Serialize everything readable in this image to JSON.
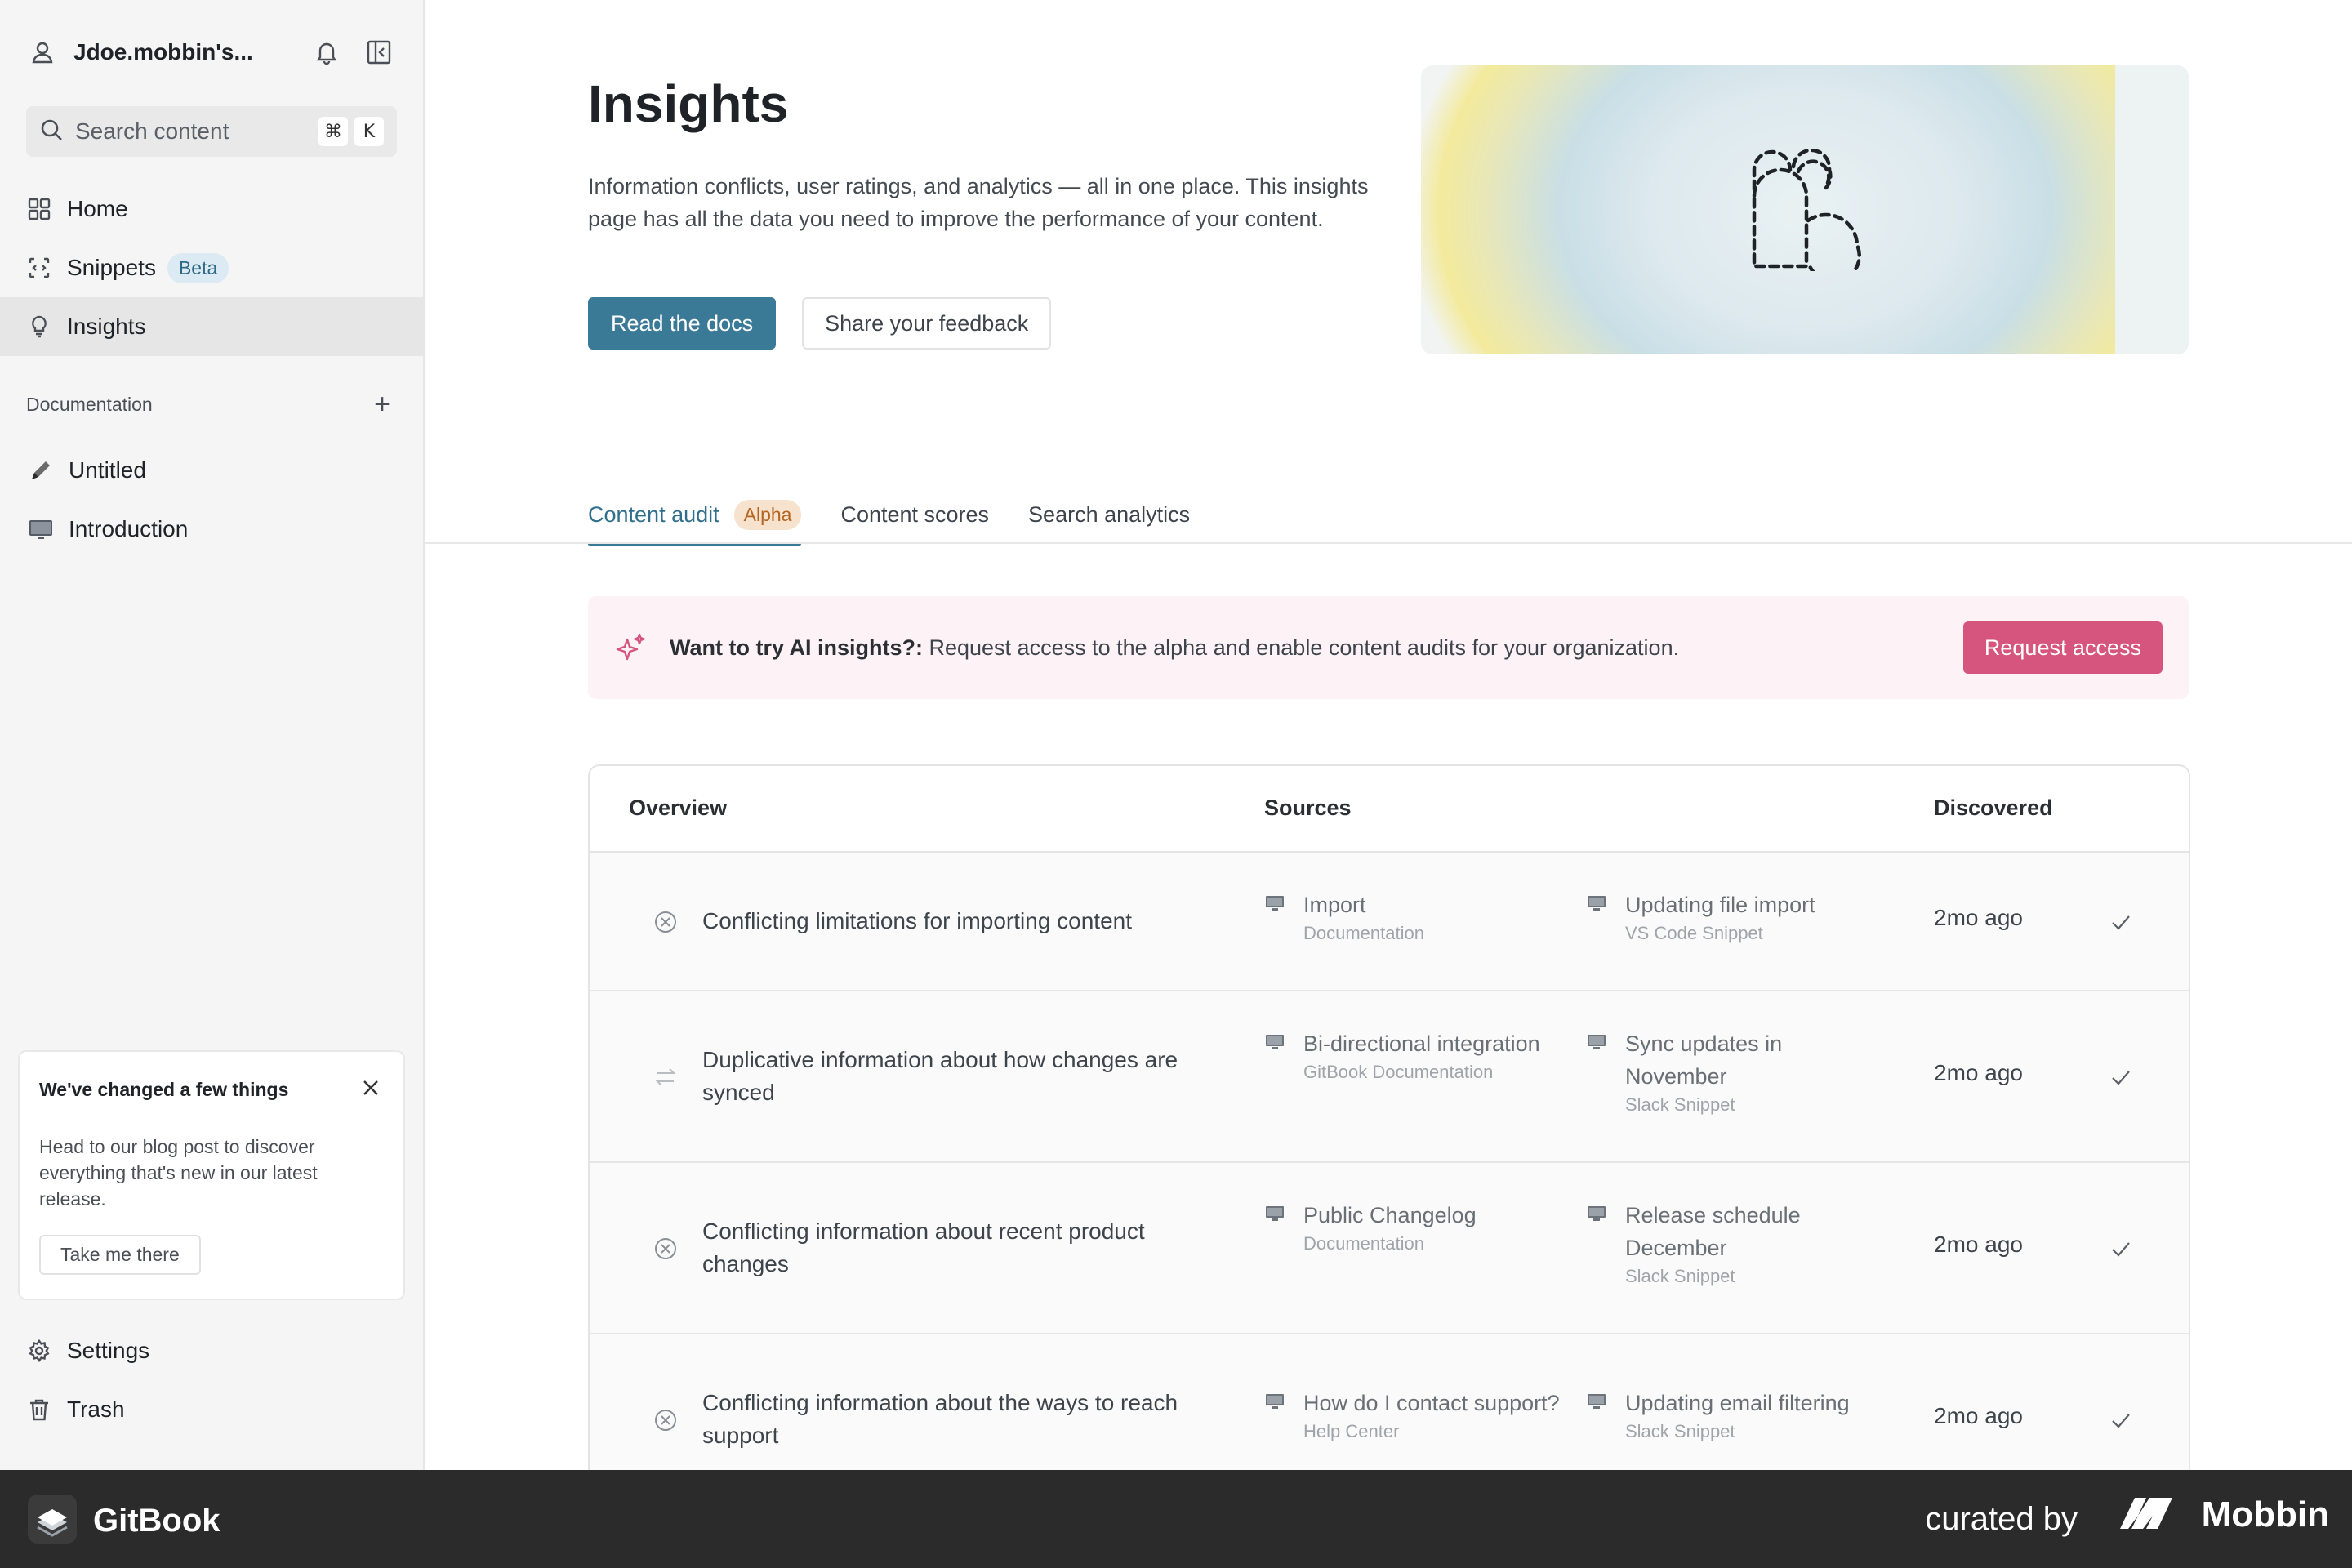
{
  "sidebar": {
    "org_name": "Jdoe.mobbin's...",
    "search": {
      "placeholder": "Search content",
      "shortcut_cmd": "⌘",
      "shortcut_key": "K"
    },
    "nav": [
      {
        "label": "Home",
        "icon": "grid-icon"
      },
      {
        "label": "Snippets",
        "icon": "snippet-icon",
        "badge": "Beta"
      },
      {
        "label": "Insights",
        "icon": "lightbulb-icon",
        "active": true
      }
    ],
    "section_label": "Documentation",
    "docs": [
      {
        "label": "Untitled",
        "icon": "pencil-icon"
      },
      {
        "label": "Introduction",
        "icon": "monitor-icon"
      }
    ],
    "notice": {
      "title": "We've changed a few things",
      "body": "Head to our blog post to discover everything that's new in our latest release.",
      "button": "Take me there"
    },
    "bottom": [
      {
        "label": "Settings",
        "icon": "gear-icon"
      },
      {
        "label": "Trash",
        "icon": "trash-icon"
      }
    ]
  },
  "hero": {
    "title": "Insights",
    "description": "Information conflicts, user ratings, and analytics — all in one place. This insights page has all the data you need to improve the performance of your content.",
    "primary_button": "Read the docs",
    "secondary_button": "Share your feedback"
  },
  "tabs": [
    {
      "label": "Content audit",
      "badge": "Alpha",
      "active": true
    },
    {
      "label": "Content scores"
    },
    {
      "label": "Search analytics"
    }
  ],
  "banner": {
    "bold": "Want to try AI insights?:",
    "text": " Request access to the alpha and enable content audits for your organization.",
    "button": "Request access",
    "accent": "#d6557f"
  },
  "table": {
    "headers": {
      "overview": "Overview",
      "sources": "Sources",
      "discovered": "Discovered"
    },
    "rows": [
      {
        "icon": "conflict-icon",
        "title": "Conflicting limitations for importing content",
        "sources": [
          {
            "name": "Import",
            "type": "Documentation"
          },
          {
            "name": "Updating file import",
            "type": "VS Code Snippet"
          }
        ],
        "discovered": "2mo ago"
      },
      {
        "icon": "duplicate-icon",
        "title": "Duplicative information about how changes are synced",
        "sources": [
          {
            "name": "Bi-directional integration",
            "type": "GitBook Documentation"
          },
          {
            "name": "Sync updates in November",
            "type": "Slack Snippet"
          }
        ],
        "discovered": "2mo ago"
      },
      {
        "icon": "conflict-icon",
        "title": "Conflicting information about recent product changes",
        "sources": [
          {
            "name": "Public Changelog",
            "type": "Documentation"
          },
          {
            "name": "Release schedule December",
            "type": "Slack Snippet"
          }
        ],
        "discovered": "2mo ago"
      },
      {
        "icon": "conflict-icon",
        "title": "Conflicting information about the ways to reach support",
        "sources": [
          {
            "name": "How do I contact support?",
            "type": "Help Center"
          },
          {
            "name": "Updating email filtering",
            "type": "Slack Snippet"
          }
        ],
        "discovered": "2mo ago"
      }
    ]
  },
  "footer": {
    "brand": "GitBook",
    "curated_by": "curated by",
    "curator": "Mobbin"
  },
  "colors": {
    "primary": "#3a7a96",
    "pink": "#d6557f",
    "sidebar_bg": "#f5f5f5"
  }
}
